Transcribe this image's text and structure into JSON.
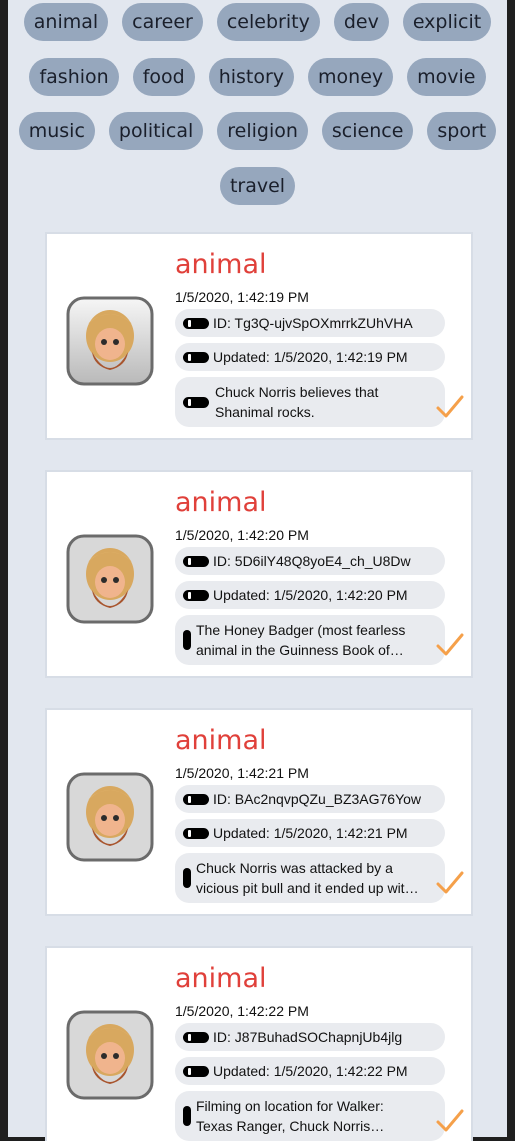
{
  "categories": {
    "row1": [
      "animal",
      "career",
      "celebrity",
      "dev",
      "explicit"
    ],
    "row2": [
      "fashion",
      "food",
      "history",
      "money",
      "movie"
    ],
    "row3": [
      "music",
      "political",
      "religion",
      "science",
      "sport"
    ],
    "row4": [
      "travel"
    ]
  },
  "cards": [
    {
      "title": "animal",
      "date": "1/5/2020, 1:42:19 PM",
      "id_text": "ID: Tg3Q-ujvSpOXmrrkZUhVHA",
      "updated_text": "Updated: 1/5/2020, 1:42:19 PM",
      "message": "Chuck Norris believes that Shanimal rocks."
    },
    {
      "title": "animal",
      "date": "1/5/2020, 1:42:20 PM",
      "id_text": "ID: 5D6ilY48Q8yoE4_ch_U8Dw",
      "updated_text": "Updated: 1/5/2020, 1:42:20 PM",
      "message": "The Honey Badger (most fearless animal in the Guinness Book of…"
    },
    {
      "title": "animal",
      "date": "1/5/2020, 1:42:21 PM",
      "id_text": "ID: BAc2nqvpQZu_BZ3AG76Yow",
      "updated_text": "Updated: 1/5/2020, 1:42:21 PM",
      "message": "Chuck Norris was attacked by a vicious pit bull and it ended up wit…"
    },
    {
      "title": "animal",
      "date": "1/5/2020, 1:42:22 PM",
      "id_text": "ID: J87BuhadSOChapnjUb4jlg",
      "updated_text": "Updated: 1/5/2020, 1:42:22 PM",
      "message": "Filming on location for Walker: Texas Ranger, Chuck Norris brought a…"
    }
  ],
  "icons": {
    "avatar": "chuck-norris-avatar-icon",
    "badge": "black-pill-icon",
    "check": "checkmark-icon"
  },
  "colors": {
    "background": "#e2e7ef",
    "chip": "#96a7bd",
    "title": "#e0403a",
    "check": "#f5a04a"
  }
}
